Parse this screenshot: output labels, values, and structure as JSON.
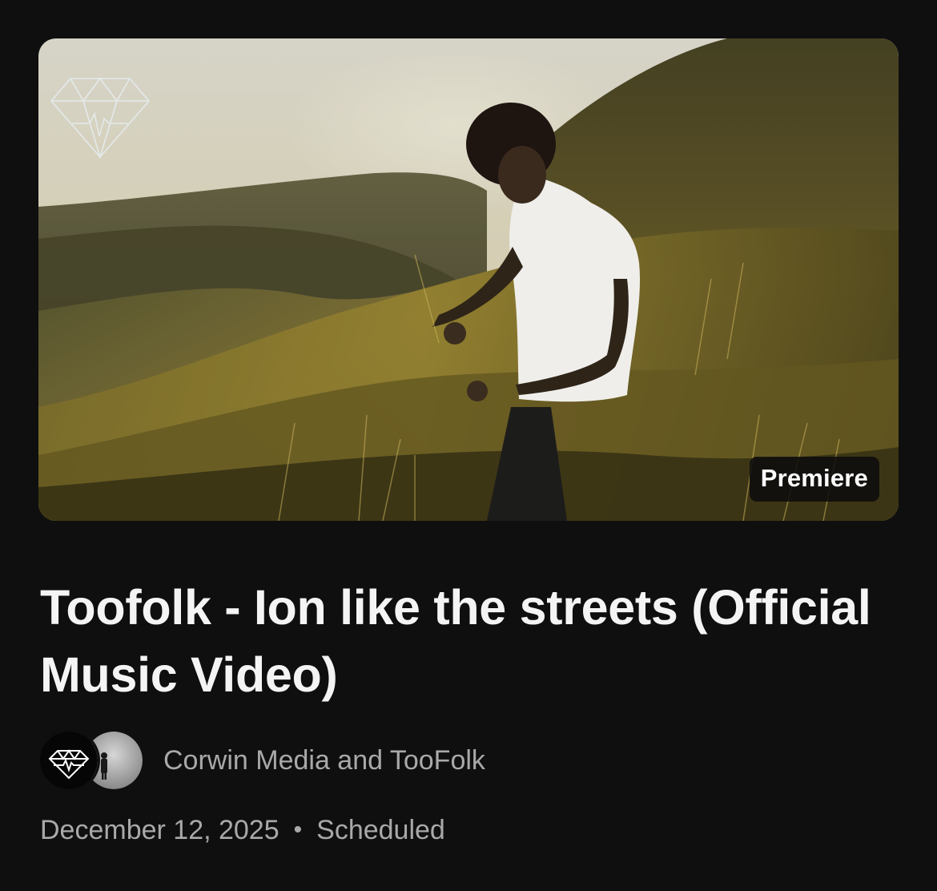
{
  "video": {
    "badge": "Premiere",
    "title": "Toofolk - Ion like the streets (Official Music Video)",
    "channels": "Corwin Media and TooFolk",
    "date": "December 12, 2025",
    "separator": "•",
    "status": "Scheduled"
  },
  "icons": {
    "watermark": "diamond-heartbeat-logo",
    "avatar_1": "diamond-heartbeat-logo",
    "avatar_2": "person-silhouette"
  },
  "colors": {
    "background": "#0f0f0f",
    "title": "#f4f4f4",
    "secondary_text": "#a9a9a9",
    "badge_bg": "#0c0c0c"
  }
}
